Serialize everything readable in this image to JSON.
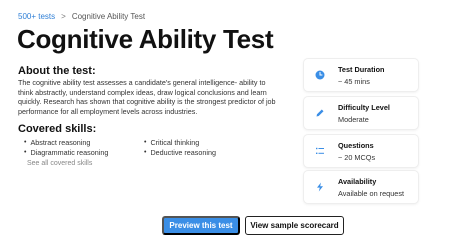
{
  "breadcrumb": {
    "parent": "500+ tests",
    "separator": ">",
    "current": "Cognitive Ability Test"
  },
  "title": "Cognitive Ability Test",
  "about": {
    "heading": "About the test:",
    "body": "The cognitive ability test assesses a candidate's general intelligence- ability to think abstractly, understand complex ideas, draw logical conclusions and learn quickly. Research has shown that cognitive ability is the strongest predictor of job performance for all employment levels across industries."
  },
  "skills": {
    "heading": "Covered skills:",
    "items": [
      "Abstract reasoning",
      "Critical thinking",
      "Diagrammatic reasoning",
      "Deductive reasoning"
    ],
    "see_all": "See all covered skills"
  },
  "cards": [
    {
      "icon": "clock-icon",
      "label": "Test Duration",
      "value": "~ 45 mins"
    },
    {
      "icon": "pencil-icon",
      "label": "Difficulty Level",
      "value": "Moderate"
    },
    {
      "icon": "list-icon",
      "label": "Questions",
      "value": "~ 20 MCQs"
    },
    {
      "icon": "lightning-icon",
      "label": "Availability",
      "value": "Available on request"
    }
  ],
  "buttons": {
    "preview": "Preview this test",
    "scorecard": "View sample scorecard"
  },
  "colors": {
    "accent": "#3a8ee6",
    "link": "#2f7fd6",
    "icon": "#3a8ee6"
  }
}
